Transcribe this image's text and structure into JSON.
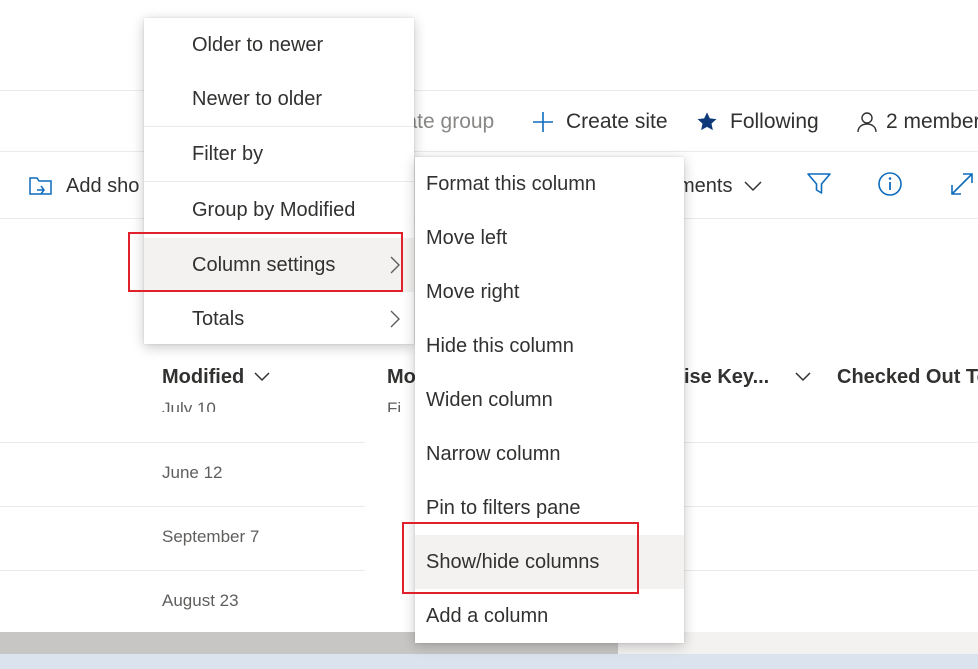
{
  "header": {
    "private_group": "vate group",
    "create_site": "Create site",
    "following": "Following",
    "members": "2 member"
  },
  "commandbar": {
    "add_shortcut": "Add sho",
    "view_selector": "ments"
  },
  "columns": {
    "modified": "Modified",
    "modified_by": "Mo",
    "enterprise_keywords": "ise Key...",
    "checked_out_to": "Checked Out To"
  },
  "rows": [
    {
      "modified": "July 10",
      "modified_by": "Fi"
    },
    {
      "modified": "June 12"
    },
    {
      "modified": "September 7"
    },
    {
      "modified": "August 23"
    }
  ],
  "context_menu": {
    "items": [
      "Older to newer",
      "Newer to older",
      "Filter by",
      "Group by Modified",
      "Column settings",
      "Totals"
    ]
  },
  "submenu": {
    "items": [
      "Format this column",
      "Move left",
      "Move right",
      "Hide this column",
      "Widen column",
      "Narrow column",
      "Pin to filters pane",
      "Show/hide columns",
      "Add a column"
    ]
  },
  "colors": {
    "accent": "#0f6cbd",
    "highlight_box": "#e0202a",
    "hover_bg": "#f3f2f1"
  }
}
